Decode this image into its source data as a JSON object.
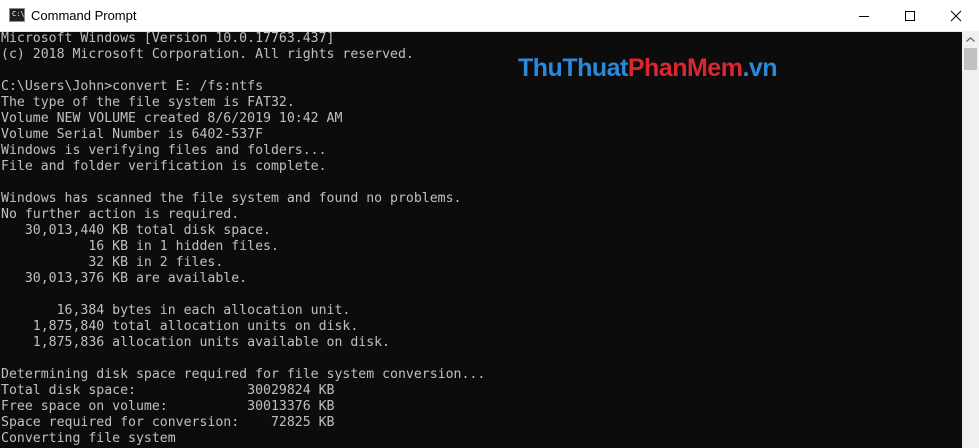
{
  "window": {
    "title": "Command Prompt",
    "app_icon_glyph": "C:\\_",
    "controls": {
      "minimize": "minimize-icon",
      "maximize": "maximize-icon",
      "close": "close-icon"
    }
  },
  "watermark": {
    "part1": "ThuThuat",
    "part2": "PhanMem",
    "part3": ".vn",
    "colors": {
      "blue": "#2a8ad9",
      "red": "#d9282f"
    }
  },
  "console": {
    "background": "#0c0c0c",
    "foreground": "#c0c0c0",
    "lines": [
      "Microsoft Windows [Version 10.0.17763.437]",
      "(c) 2018 Microsoft Corporation. All rights reserved.",
      "",
      "C:\\Users\\John>convert E: /fs:ntfs",
      "The type of the file system is FAT32.",
      "Volume NEW VOLUME created 8/6/2019 10:42 AM",
      "Volume Serial Number is 6402-537F",
      "Windows is verifying files and folders...",
      "File and folder verification is complete.",
      "",
      "Windows has scanned the file system and found no problems.",
      "No further action is required.",
      "   30,013,440 KB total disk space.",
      "           16 KB in 1 hidden files.",
      "           32 KB in 2 files.",
      "   30,013,376 KB are available.",
      "",
      "       16,384 bytes in each allocation unit.",
      "    1,875,840 total allocation units on disk.",
      "    1,875,836 allocation units available on disk.",
      "",
      "Determining disk space required for file system conversion...",
      "Total disk space:              30029824 KB",
      "Free space on volume:          30013376 KB",
      "Space required for conversion:    72825 KB",
      "Converting file system"
    ]
  }
}
